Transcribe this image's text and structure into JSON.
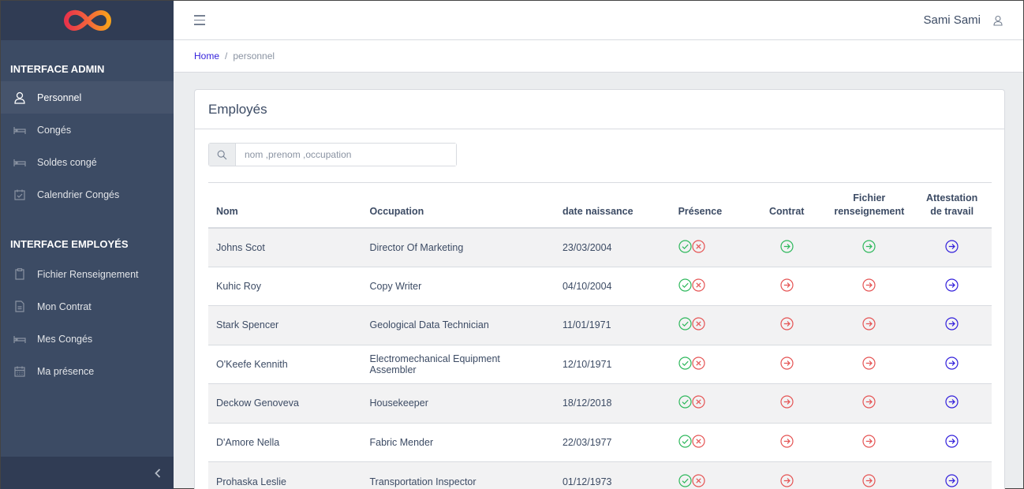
{
  "sidebar": {
    "logo": "infinity-logo",
    "sections": [
      {
        "title": "INTERFACE ADMIN",
        "items": [
          {
            "label": "Personnel",
            "icon": "user-icon",
            "active": true
          },
          {
            "label": "Congés",
            "icon": "bed-icon"
          },
          {
            "label": "Soldes congé",
            "icon": "bed-icon"
          },
          {
            "label": "Calendrier Congés",
            "icon": "calendar-check-icon"
          }
        ]
      },
      {
        "title": "INTERFACE EMPLOYÉS",
        "items": [
          {
            "label": "Fichier Renseignement",
            "icon": "clipboard-icon"
          },
          {
            "label": "Mon Contrat",
            "icon": "file-icon"
          },
          {
            "label": "Mes Congés",
            "icon": "bed-icon"
          },
          {
            "label": "Ma présence",
            "icon": "calendar-icon"
          }
        ]
      }
    ]
  },
  "header": {
    "user_name": "Sami Sami"
  },
  "breadcrumb": {
    "home": "Home",
    "separator": "/",
    "current": "personnel"
  },
  "card": {
    "title": "Employés"
  },
  "search": {
    "placeholder": "nom ,prenom ,occupation",
    "value": ""
  },
  "table": {
    "headers": {
      "nom": "Nom",
      "occupation": "Occupation",
      "date": "date naissance",
      "presence": "Présence",
      "contrat": "Contrat",
      "fichier_1": "Fichier",
      "fichier_2": "renseignement",
      "attestation_1": "Attestation",
      "attestation_2": "de travail"
    },
    "rows": [
      {
        "nom": "Johns Scot",
        "occupation": "Director Of Marketing",
        "date": "23/03/2004",
        "contrat": "green",
        "fichier": "green"
      },
      {
        "nom": "Kuhic Roy",
        "occupation": "Copy Writer",
        "date": "04/10/2004",
        "contrat": "red",
        "fichier": "red"
      },
      {
        "nom": "Stark Spencer",
        "occupation": "Geological Data Technician",
        "date": "11/01/1971",
        "contrat": "red",
        "fichier": "red"
      },
      {
        "nom": "O'Keefe Kennith",
        "occupation": "Electromechanical Equipment Assembler",
        "date": "12/10/1971",
        "contrat": "red",
        "fichier": "red"
      },
      {
        "nom": "Deckow Genoveva",
        "occupation": "Housekeeper",
        "date": "18/12/2018",
        "contrat": "red",
        "fichier": "red"
      },
      {
        "nom": "D'Amore Nella",
        "occupation": "Fabric Mender",
        "date": "22/03/1977",
        "contrat": "red",
        "fichier": "red"
      },
      {
        "nom": "Prohaska Leslie",
        "occupation": "Transportation Inspector",
        "date": "01/12/1973",
        "contrat": "red",
        "fichier": "red"
      }
    ]
  },
  "colors": {
    "green": "#2eb85c",
    "red": "#e55353",
    "blue": "#321fdb",
    "sidebar": "#3c4b64"
  }
}
